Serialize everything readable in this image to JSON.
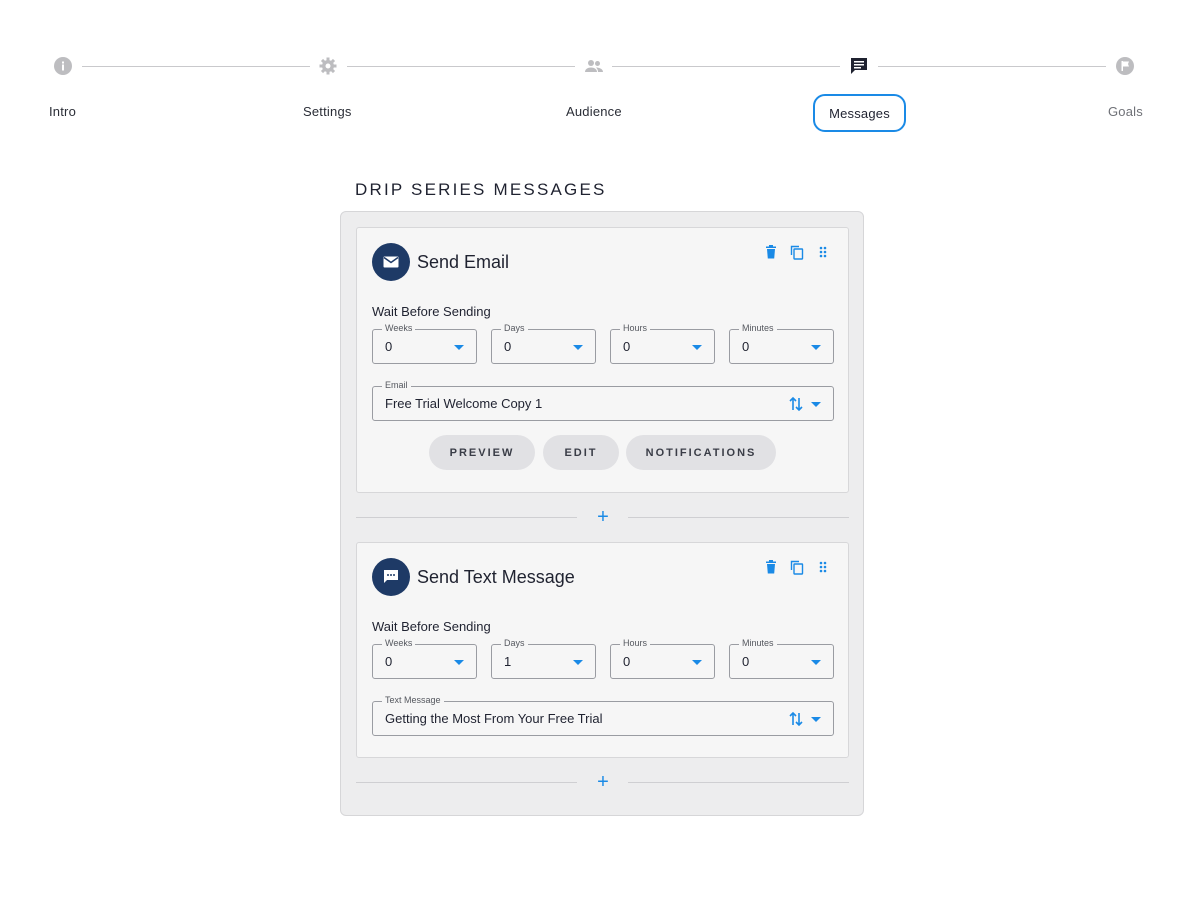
{
  "stepper": {
    "steps": [
      {
        "label": "Intro",
        "icon": "info-icon",
        "state": "completed"
      },
      {
        "label": "Settings",
        "icon": "gear-icon",
        "state": "completed"
      },
      {
        "label": "Audience",
        "icon": "people-icon",
        "state": "completed"
      },
      {
        "label": "Messages",
        "icon": "chat-icon",
        "state": "active"
      },
      {
        "label": "Goals",
        "icon": "flag-icon",
        "state": "upcoming"
      }
    ]
  },
  "section": {
    "title": "DRIP SERIES MESSAGES"
  },
  "cards": [
    {
      "title": "Send Email",
      "icon": "envelope-icon",
      "wait_label": "Wait Before Sending",
      "wait": [
        {
          "label": "Weeks",
          "value": "0"
        },
        {
          "label": "Days",
          "value": "0"
        },
        {
          "label": "Hours",
          "value": "0"
        },
        {
          "label": "Minutes",
          "value": "0"
        }
      ],
      "content_field": {
        "label": "Email",
        "value": "Free Trial Welcome Copy 1"
      },
      "buttons": {
        "preview": "PREVIEW",
        "edit": "EDIT",
        "notifications": "NOTIFICATIONS"
      }
    },
    {
      "title": "Send Text Message",
      "icon": "sms-icon",
      "wait_label": "Wait Before Sending",
      "wait": [
        {
          "label": "Weeks",
          "value": "0"
        },
        {
          "label": "Days",
          "value": "1"
        },
        {
          "label": "Hours",
          "value": "0"
        },
        {
          "label": "Minutes",
          "value": "0"
        }
      ],
      "content_field": {
        "label": "Text Message",
        "value": "Getting the Most From Your Free Trial"
      }
    }
  ],
  "add_symbol": "+",
  "colors": {
    "accent": "#1a8ae6",
    "avatar": "#1e3a66",
    "panel": "#ededee",
    "card": "#f6f6f6",
    "pill": "#e1e1e4",
    "step_inactive": "#bdbdc0",
    "step_active": "#1f2230"
  }
}
